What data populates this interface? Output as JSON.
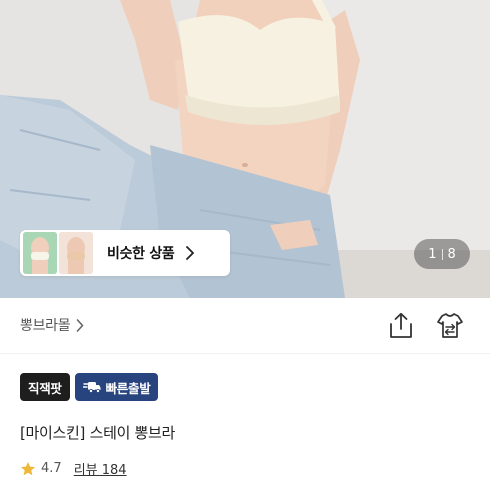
{
  "hero": {
    "similar_products_label": "비슷한 상품",
    "page_current": "1",
    "page_total": "8",
    "icons": {
      "chevron": "chevron-right-icon"
    },
    "colors": {
      "skin": "#f1d2be",
      "top": "#f5f0e0",
      "jeans": "#b9cad9"
    }
  },
  "brand": {
    "name": "뽕브라몰",
    "icons": {
      "share": "share-icon",
      "compare": "compare-icon"
    }
  },
  "badges": {
    "direct_purchase": "직잭팟",
    "fast_delivery": "빠른출발",
    "colors": {
      "direct_purchase_bg": "#1e1e1e",
      "fast_delivery_bg": "#28447f"
    }
  },
  "product": {
    "title": "[마이스킨] 스테이 뽕브라"
  },
  "rating": {
    "score": "4.7",
    "review_label": "리뷰 184",
    "star_color": "#f0b83a"
  }
}
